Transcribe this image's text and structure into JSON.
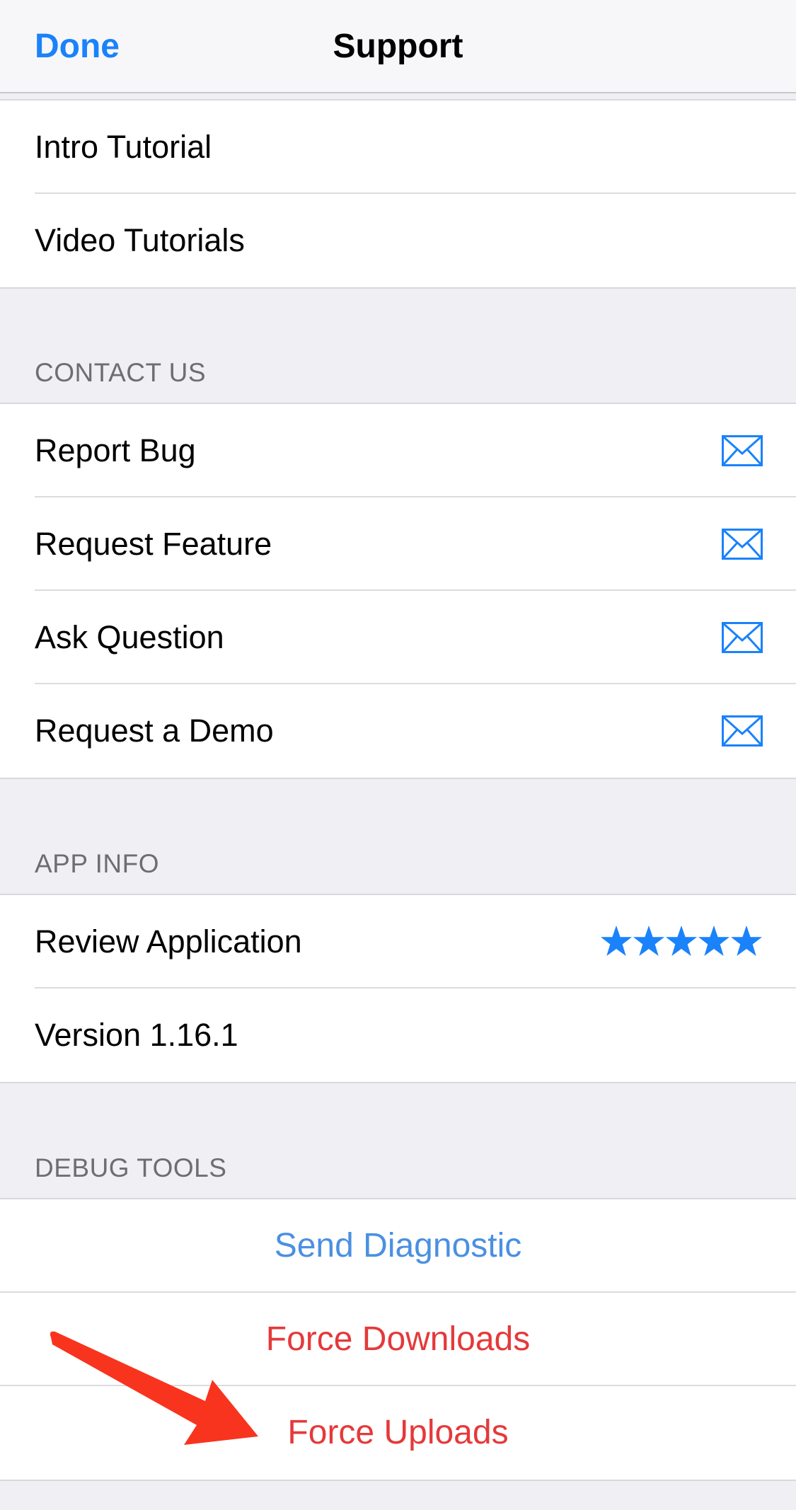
{
  "navbar": {
    "done_label": "Done",
    "title": "Support"
  },
  "tutorials": {
    "items": [
      {
        "label": "Intro Tutorial"
      },
      {
        "label": "Video Tutorials"
      }
    ]
  },
  "contact": {
    "header": "CONTACT US",
    "items": [
      {
        "label": "Report Bug",
        "icon": "mail-icon"
      },
      {
        "label": "Request Feature",
        "icon": "mail-icon"
      },
      {
        "label": "Ask Question",
        "icon": "mail-icon"
      },
      {
        "label": "Request a Demo",
        "icon": "mail-icon"
      }
    ]
  },
  "app_info": {
    "header": "APP INFO",
    "review_label": "Review Application",
    "rating": 5,
    "version_label": "Version 1.16.1"
  },
  "debug": {
    "header": "DEBUG TOOLS",
    "send_diagnostic": "Send Diagnostic",
    "force_downloads": "Force Downloads",
    "force_uploads": "Force Uploads"
  },
  "colors": {
    "accent": "#1a82fb",
    "link_blue": "#4a90e2",
    "destructive": "#e5393a",
    "annotation_arrow": "#f8341e"
  }
}
